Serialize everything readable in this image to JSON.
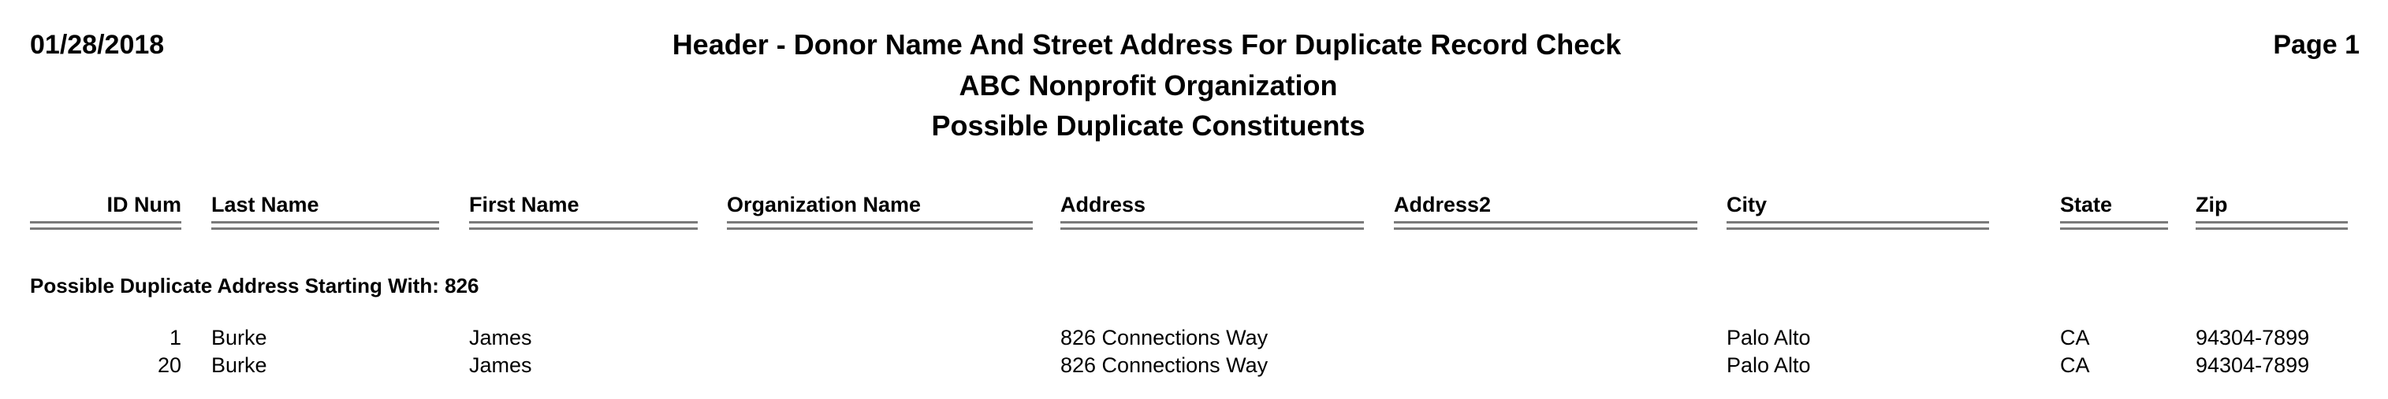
{
  "report": {
    "date": "01/28/2018",
    "page": "Page 1",
    "title": "Header - Donor Name And Street Address For Duplicate Record Check",
    "organization": "ABC Nonprofit Organization",
    "subtitle": "Possible Duplicate Constituents"
  },
  "columns": {
    "id_num": "ID Num",
    "last_name": "Last Name",
    "first_name": "First Name",
    "organization_name": "Organization Name",
    "address": "Address",
    "address2": "Address2",
    "city": "City",
    "state": "State",
    "zip": "Zip"
  },
  "groups": [
    {
      "label": "Possible Duplicate Address Starting With: 826",
      "rows": [
        {
          "id_num": "1",
          "last_name": "Burke",
          "first_name": "James",
          "organization_name": "",
          "address": "826 Connections Way",
          "address2": "",
          "city": "Palo Alto",
          "state": "CA",
          "zip": "94304-7899"
        },
        {
          "id_num": "20",
          "last_name": "Burke",
          "first_name": "James",
          "organization_name": "",
          "address": "826 Connections Way",
          "address2": "",
          "city": "Palo Alto",
          "state": "CA",
          "zip": "94304-7899"
        }
      ]
    }
  ]
}
